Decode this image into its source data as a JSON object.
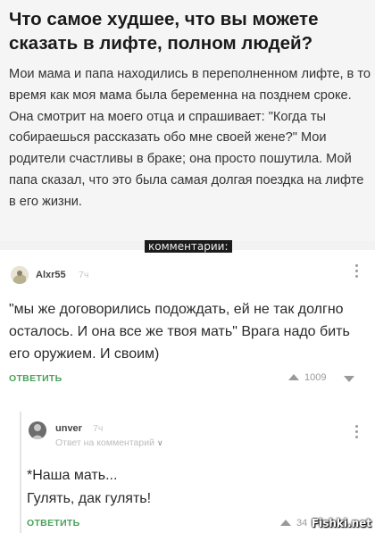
{
  "post": {
    "title": "Что самое худшее, что вы можете сказать в лифте, полном людей?",
    "body": "Мои мама и папа находились в переполненном лифте, в то время как моя мама была беременна на позднем сроке. Она смотрит на моего отца и спрашивает: \"Когда ты собираешься рассказать обо мне своей жене?\" Мои родители счастливы в браке; она просто пошутила. Мой папа сказал, что это была самая долгая поездка на лифте в его жизни."
  },
  "overlay": {
    "comments_label": "комментарии:"
  },
  "comment": {
    "username": "Alxr55",
    "time": "7ч",
    "text": "\"мы же договорились подождать, ей не так долгно осталось. И она все же твоя мать\" Врага надо бить его оружием. И своим)",
    "reply_label": "ОТВЕТИТЬ",
    "votes": "1009"
  },
  "reply": {
    "username": "unver",
    "time": "7ч",
    "reply_to": "Ответ на комментарий",
    "text_line1": "*Наша мать...",
    "text_line2": "Гулять, дак гулять!",
    "reply_label": "ОТВЕТИТЬ",
    "votes": "34"
  },
  "watermark": "Fishki.net",
  "icons": {
    "avatar": "user-avatar-icon",
    "more": "kebab-menu-icon",
    "upvote": "triangle-up-icon",
    "downvote": "triangle-down-icon",
    "chevron": "chevron-down-icon"
  },
  "colors": {
    "accent_green": "#48a25a",
    "muted": "#9a9a9a",
    "background": "#f2f2f2"
  }
}
